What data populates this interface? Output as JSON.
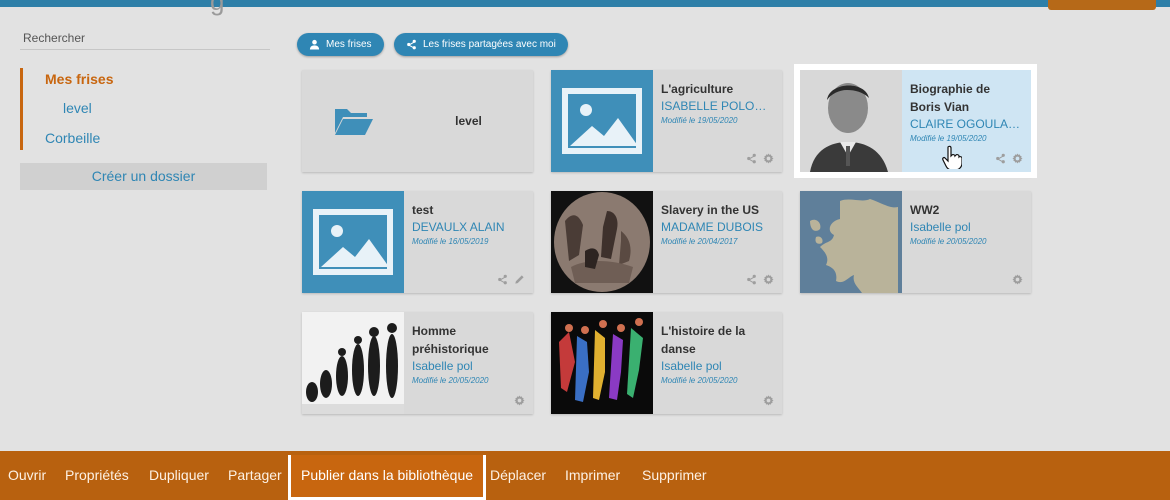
{
  "header": {
    "title_fragment": "g"
  },
  "sidebar": {
    "search_placeholder": "Rechercher",
    "items": [
      {
        "label": "Mes frises",
        "active": true
      },
      {
        "label": "level",
        "active": false
      },
      {
        "label": "Corbeille",
        "active": false
      }
    ],
    "create_folder_label": "Créer un dossier"
  },
  "filters": {
    "mine_label": "Mes frises",
    "shared_label": "Les frises partagées avec moi"
  },
  "cards": [
    {
      "type": "folder",
      "title": "level"
    },
    {
      "title": "L'agriculture",
      "author": "ISABELLE POLONI...",
      "modified": "Modifié le 19/05/2020",
      "thumb": "image-placeholder",
      "actions": [
        "share-icon",
        "gear-icon"
      ]
    },
    {
      "title": "Biographie de Boris Vian",
      "author": "CLAIRE OGOULA-N...",
      "modified": "Modifié le 19/05/2020",
      "thumb": "portrait-photo",
      "actions": [
        "share-icon",
        "gear-icon"
      ],
      "highlighted": true
    },
    {
      "title": "test",
      "author": "DEVAULX ALAIN",
      "modified": "Modifié le 16/05/2019",
      "thumb": "image-placeholder",
      "actions": [
        "share-icon",
        "pencil-icon"
      ]
    },
    {
      "title": "Slavery in the US",
      "author": "MADAME DUBOIS",
      "modified": "Modifié le 20/04/2017",
      "thumb": "engraving-photo",
      "actions": [
        "share-icon",
        "gear-icon"
      ]
    },
    {
      "title": "WW2",
      "author": "Isabelle pol",
      "modified": "Modifié le 20/05/2020",
      "thumb": "europe-map",
      "actions": [
        "gear-icon"
      ]
    },
    {
      "title": "Homme préhistorique",
      "author": "Isabelle pol",
      "modified": "Modifié le 20/05/2020",
      "thumb": "evolution-silhouettes",
      "actions": [
        "gear-icon"
      ]
    },
    {
      "title": "L'histoire de la danse",
      "author": "Isabelle pol",
      "modified": "Modifié le 20/05/2020",
      "thumb": "dancers-painting",
      "actions": [
        "gear-icon"
      ]
    }
  ],
  "toolbar": {
    "items": [
      {
        "label": "Ouvrir"
      },
      {
        "label": "Propriétés"
      },
      {
        "label": "Dupliquer"
      },
      {
        "label": "Partager"
      },
      {
        "label": "Publier dans la bibliothèque",
        "focused": true
      },
      {
        "label": "Déplacer"
      },
      {
        "label": "Imprimer"
      },
      {
        "label": "Supprimer"
      }
    ]
  },
  "colors": {
    "accent_orange": "#c8660f",
    "primary_blue": "#2f86b4",
    "toolbar_bg": "#b8610f"
  }
}
